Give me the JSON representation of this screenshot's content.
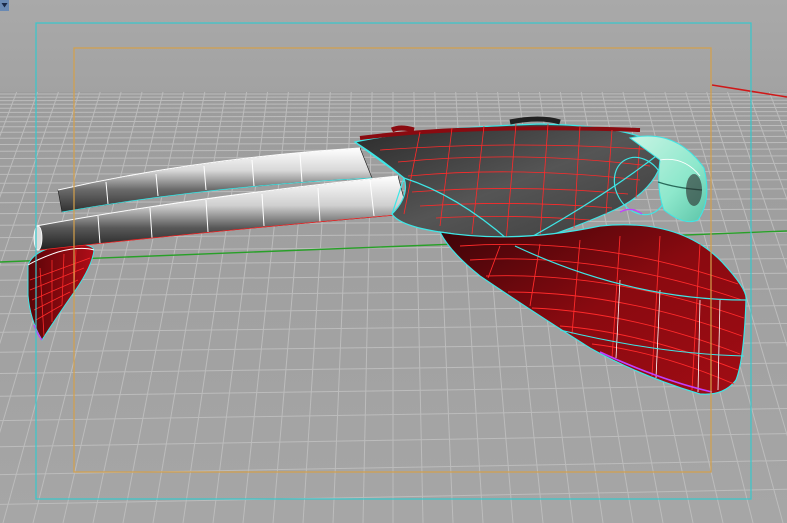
{
  "viewport": {
    "label": "",
    "background_color": "#a5a5a5",
    "grid_color": "#bcbcbc",
    "axis_x_color": "#d01818",
    "axis_y_color": "#28a028",
    "camera_frame_color": "#36c8cc",
    "safe_frame_color": "#d4a04a"
  },
  "model": {
    "name": "",
    "shading": "shaded-wireframe",
    "surface_color": "#8a0a10",
    "wire_color": "#ff2a2a",
    "boundary_color": "#3ee6e6",
    "canopy_color": "#8ee8cc",
    "tube_color": "#e8e8e8"
  },
  "icons": {
    "corner": "viewport-menu-icon"
  }
}
